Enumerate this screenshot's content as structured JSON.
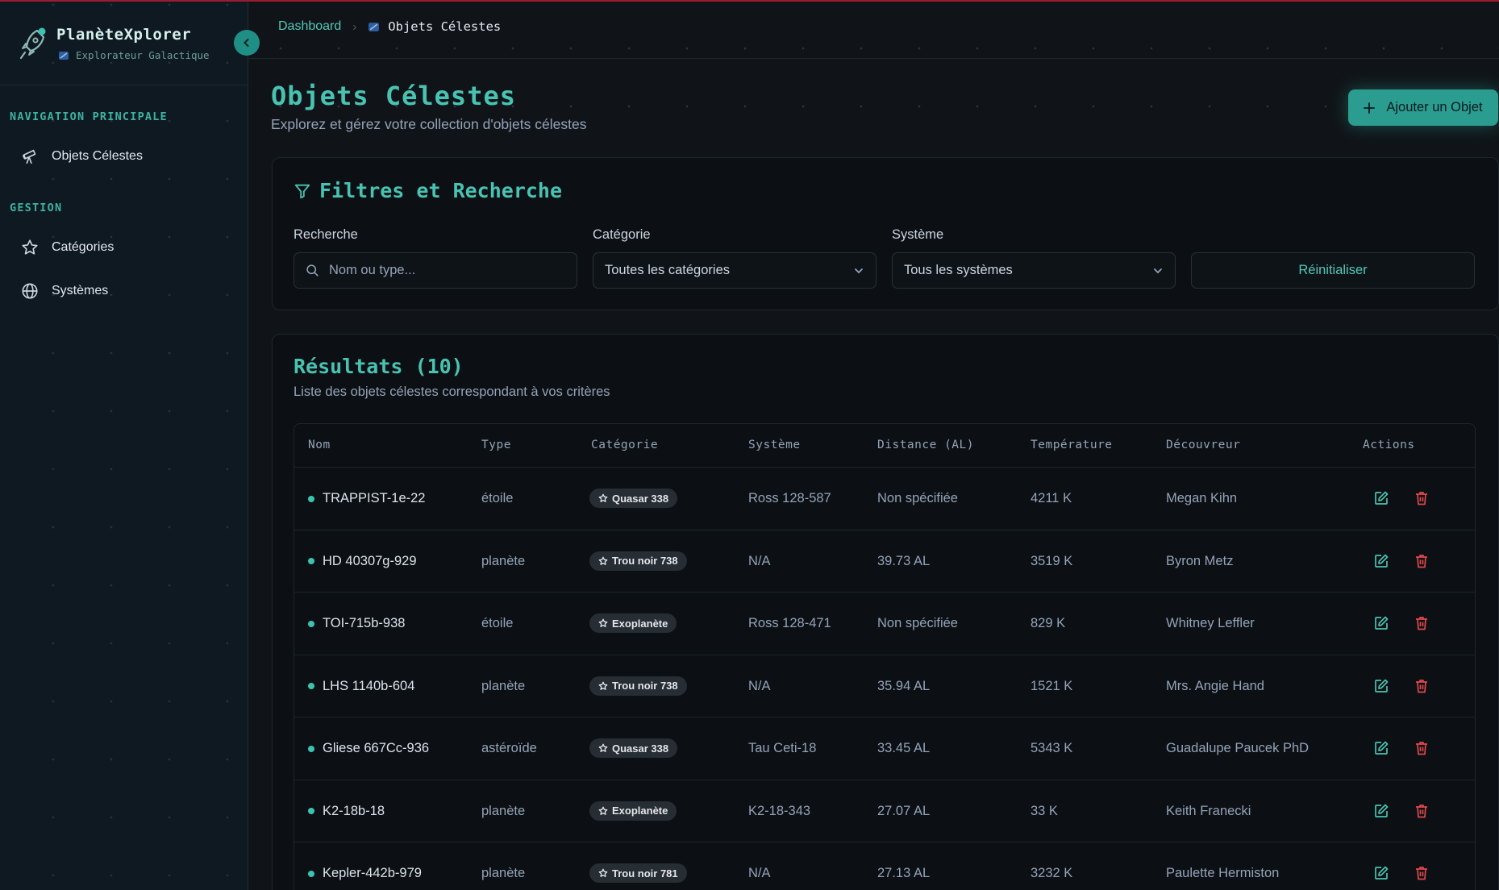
{
  "brand": {
    "name": "PlanèteXplorer",
    "subtitle": "Explorateur Galactique"
  },
  "sidebar": {
    "sections": [
      {
        "title": "NAVIGATION PRINCIPALE",
        "items": [
          {
            "label": "Objets Célestes",
            "icon": "telescope-icon"
          }
        ]
      },
      {
        "title": "GESTION",
        "items": [
          {
            "label": "Catégories",
            "icon": "star-icon"
          },
          {
            "label": "Systèmes",
            "icon": "globe-icon"
          }
        ]
      }
    ]
  },
  "breadcrumb": {
    "home": "Dashboard",
    "current": "Objets Célestes"
  },
  "page": {
    "title": "Objets Célestes",
    "subtitle": "Explorez et gérez votre collection d'objets célestes",
    "add_button": "Ajouter un Objet"
  },
  "filters": {
    "title": "Filtres et Recherche",
    "search": {
      "label": "Recherche",
      "placeholder": "Nom ou type..."
    },
    "category": {
      "label": "Catégorie",
      "value": "Toutes les catégories"
    },
    "system": {
      "label": "Système",
      "value": "Tous les systèmes"
    },
    "reset": "Réinitialiser"
  },
  "results": {
    "title": "Résultats (10)",
    "subtitle": "Liste des objets célestes correspondant à vos critères",
    "columns": [
      "Nom",
      "Type",
      "Catégorie",
      "Système",
      "Distance (AL)",
      "Température",
      "Découvreur",
      "Actions"
    ],
    "rows": [
      {
        "name": "TRAPPIST-1e-22",
        "type": "étoile",
        "category": "Quasar 338",
        "system": "Ross 128-587",
        "distance": "Non spécifiée",
        "temperature": "4211 K",
        "discoverer": "Megan Kihn"
      },
      {
        "name": "HD 40307g-929",
        "type": "planète",
        "category": "Trou noir 738",
        "system": "N/A",
        "distance": "39.73 AL",
        "temperature": "3519 K",
        "discoverer": "Byron Metz"
      },
      {
        "name": "TOI-715b-938",
        "type": "étoile",
        "category": "Exoplanète",
        "system": "Ross 128-471",
        "distance": "Non spécifiée",
        "temperature": "829 K",
        "discoverer": "Whitney Leffler"
      },
      {
        "name": "LHS 1140b-604",
        "type": "planète",
        "category": "Trou noir 738",
        "system": "N/A",
        "distance": "35.94 AL",
        "temperature": "1521 K",
        "discoverer": "Mrs. Angie Hand"
      },
      {
        "name": "Gliese 667Cc-936",
        "type": "astéroïde",
        "category": "Quasar 338",
        "system": "Tau Ceti-18",
        "distance": "33.45 AL",
        "temperature": "5343 K",
        "discoverer": "Guadalupe Paucek PhD"
      },
      {
        "name": "K2-18b-18",
        "type": "planète",
        "category": "Exoplanète",
        "system": "K2-18-343",
        "distance": "27.07 AL",
        "temperature": "33 K",
        "discoverer": "Keith Franecki"
      },
      {
        "name": "Kepler-442b-979",
        "type": "planète",
        "category": "Trou noir 781",
        "system": "N/A",
        "distance": "27.13 AL",
        "temperature": "3232 K",
        "discoverer": "Paulette Hermiston"
      }
    ]
  },
  "colors": {
    "accent": "#48c3b2",
    "delete": "#e0484b",
    "background": "#101418"
  }
}
